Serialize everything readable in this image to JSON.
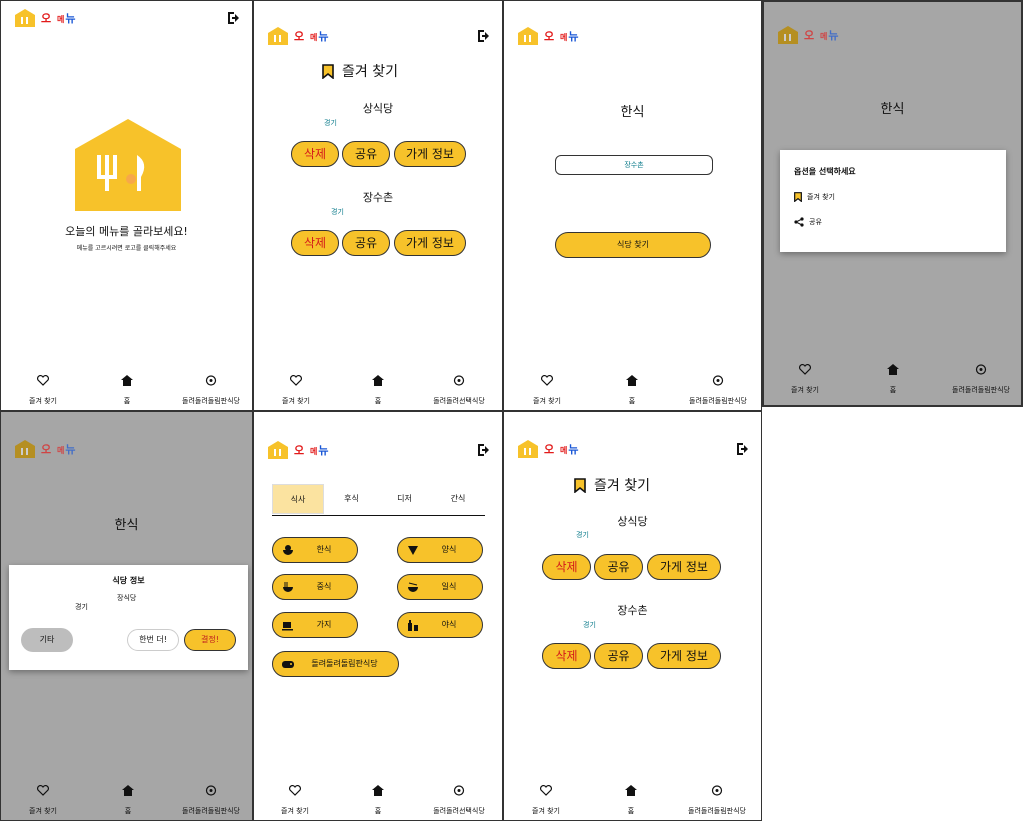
{
  "logo": {
    "o": "오",
    "m": "메",
    "b": "뉴"
  },
  "nav": {
    "favorites": "즐겨 찾기",
    "home": "홈",
    "random": "돌려돌려돌림판식당"
  },
  "nav_alt": {
    "random": "돌려돌려선택식당"
  },
  "s1": {
    "title": "오늘의 메뉴를 골라보세요!",
    "subtitle": "메뉴를 고르시려면 로고를 클릭해주세요"
  },
  "fav": {
    "title": "즐겨 찾기",
    "items": [
      {
        "name": "상식당",
        "region": "경기"
      },
      {
        "name": "장수촌",
        "region": "경기"
      }
    ],
    "delete": "삭제",
    "share": "공유",
    "info": "가게 정보"
  },
  "s3": {
    "category": "한식",
    "result": "장수촌",
    "find": "식당 찾기"
  },
  "s4": {
    "category": "한식",
    "dialog_title": "옵션을 선택하세요",
    "opt_fav": "즐겨 찾기",
    "opt_share": "공유"
  },
  "s5": {
    "category": "한식",
    "dialog_title": "식당 정보",
    "name": "장식당",
    "region": "경기",
    "other": "기타",
    "again": "한번 더!",
    "decide": "결정!"
  },
  "s6": {
    "tabs": [
      "식사",
      "후식",
      "디저",
      "간식"
    ],
    "cats": [
      "한식",
      "양식",
      "중식",
      "일식",
      "가지",
      "야식"
    ],
    "roulette": "돌려돌려돌림판식당"
  },
  "colors": {
    "accent": "#f7c22a",
    "gray": "#a6a6a6",
    "teal": "#0a7a8a",
    "red": "#e21b1b"
  }
}
